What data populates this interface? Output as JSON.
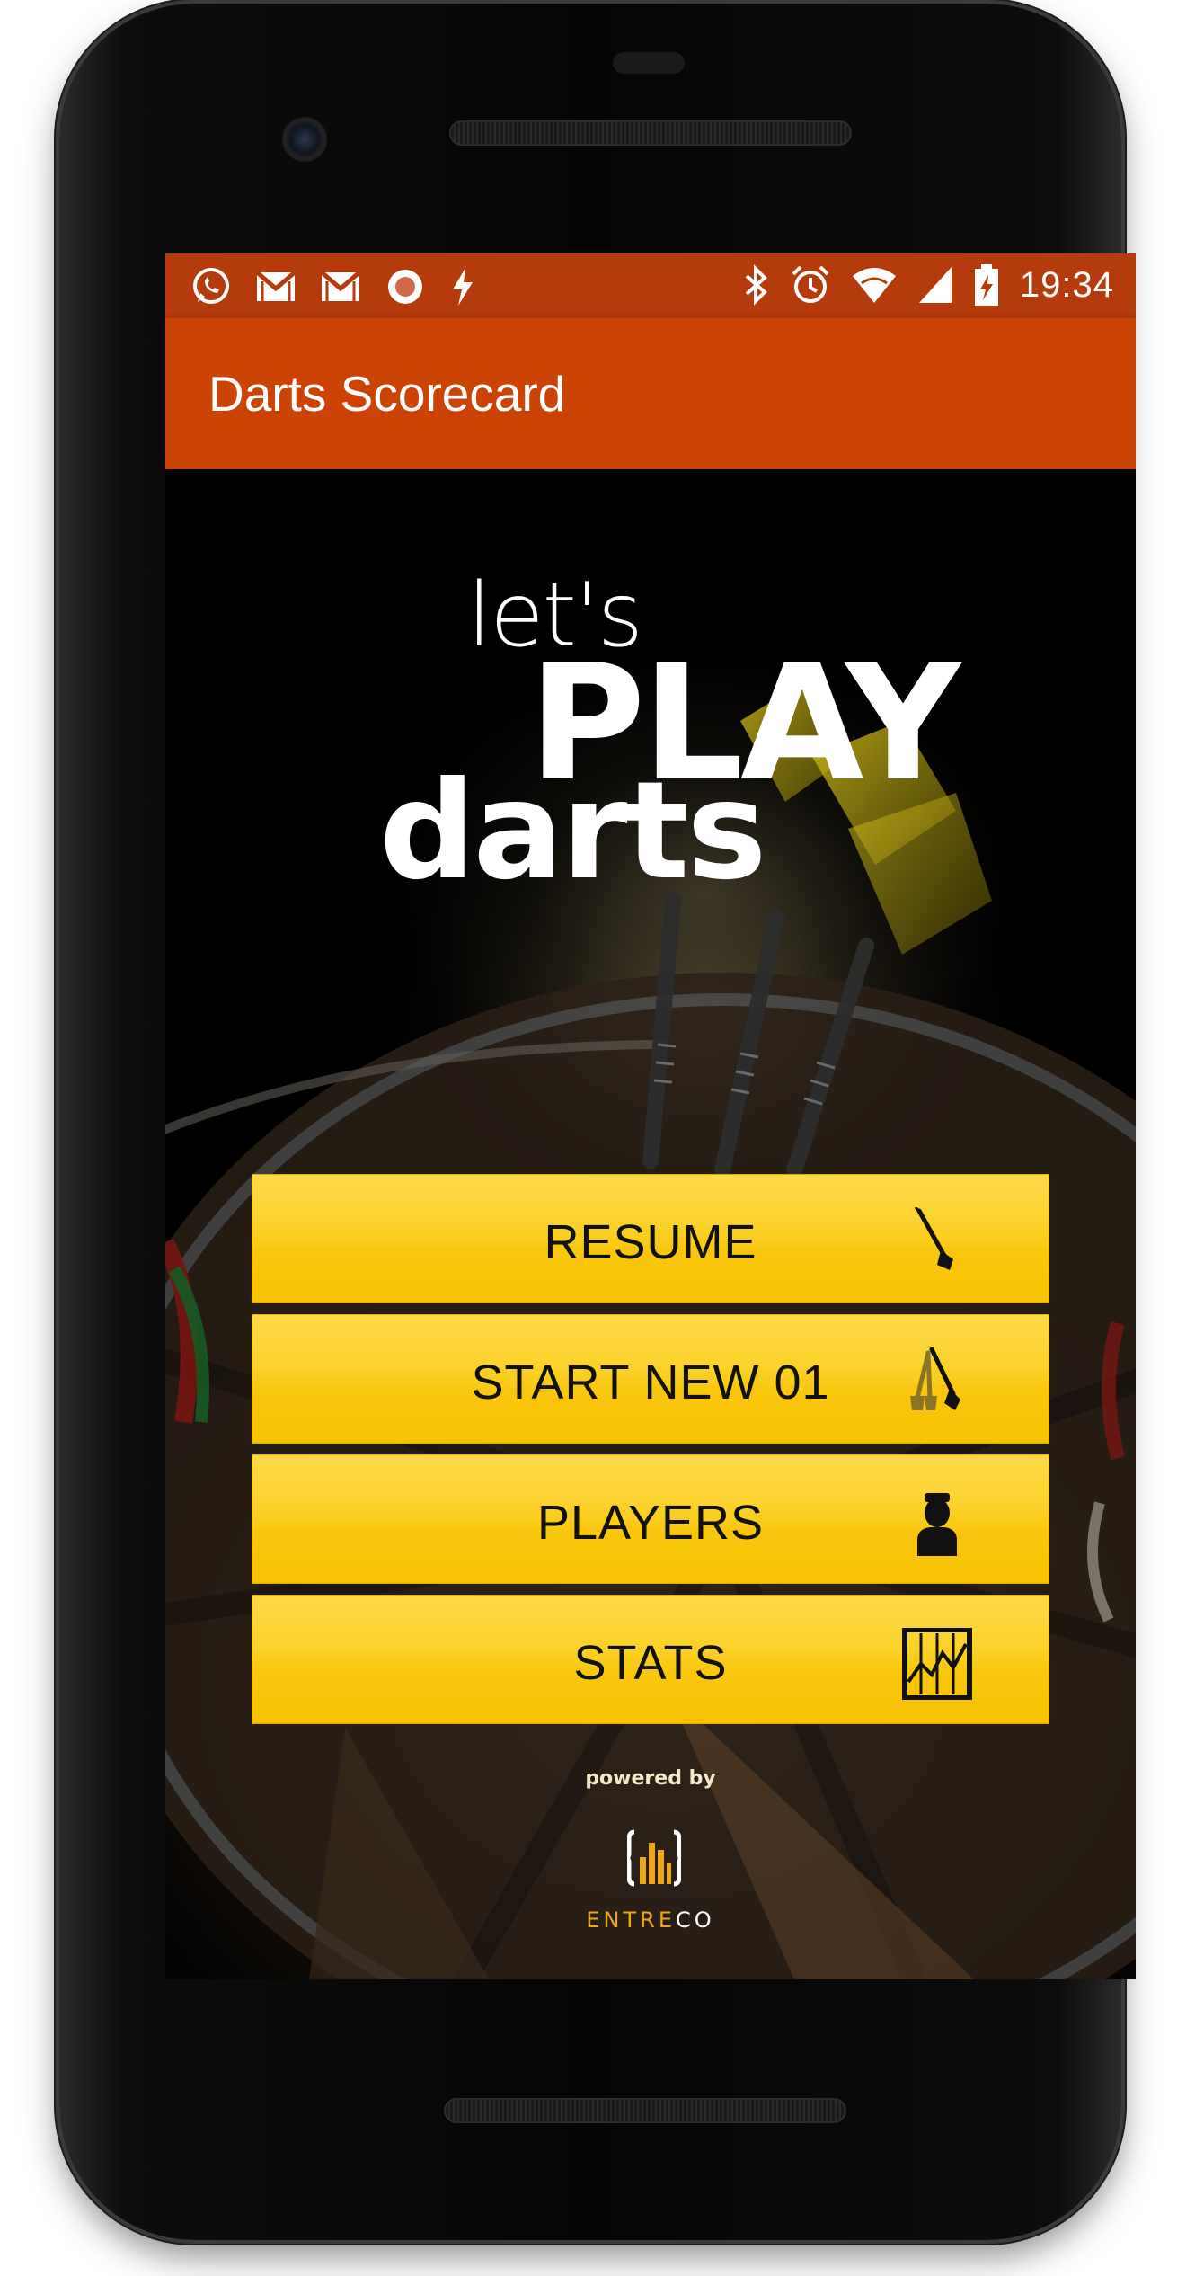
{
  "status_bar": {
    "time": "19:34",
    "left_icons": [
      "whatsapp-icon",
      "gmail-icon",
      "gmail-icon",
      "record-icon",
      "flash-icon"
    ],
    "right_icons": [
      "bluetooth-icon",
      "alarm-icon",
      "wifi-icon",
      "signal-icon",
      "battery-charging-icon"
    ],
    "color": "#b53a0c"
  },
  "app_bar": {
    "title": "Darts Scorecard",
    "color": "#cc4405"
  },
  "headline": {
    "line1": "let's",
    "line2": "PLAY",
    "line3": "darts"
  },
  "menu": {
    "button_color": "#fbd22b",
    "items": [
      {
        "label": "RESUME",
        "icon": "dart-icon"
      },
      {
        "label": "START NEW 01",
        "icon": "darts-pair-icon"
      },
      {
        "label": "PLAYERS",
        "icon": "player-icon"
      },
      {
        "label": "STATS",
        "icon": "stats-chart-icon"
      }
    ]
  },
  "footer": {
    "powered_by": "powered by",
    "brand_part1": "ENTRE",
    "brand_part2": "CO",
    "brand_color": "#f0a61b"
  }
}
